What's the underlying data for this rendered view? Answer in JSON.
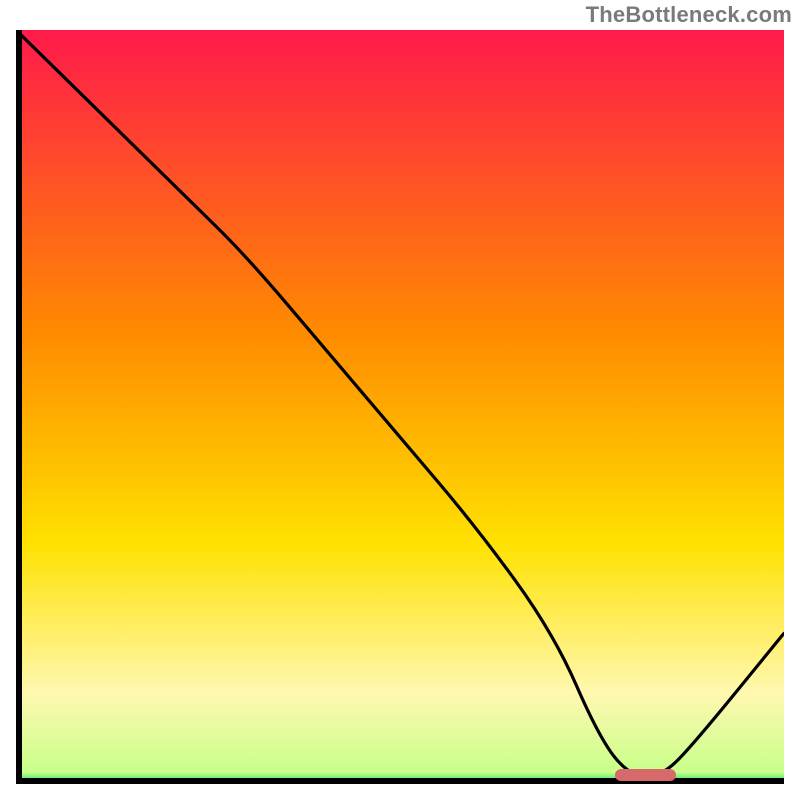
{
  "watermark": "TheBottleneck.com",
  "colors": {
    "gradient_top": "#ff1a4b",
    "gradient_mid1": "#ff8a00",
    "gradient_mid2": "#ffe100",
    "gradient_mid3": "#fff8b0",
    "gradient_bottom": "#00e05a",
    "axis": "#000000",
    "curve": "#000000",
    "marker": "#d66a6a"
  },
  "chart_data": {
    "type": "line",
    "title": "",
    "xlabel": "",
    "ylabel": "",
    "xlim": [
      0,
      100
    ],
    "ylim": [
      0,
      100
    ],
    "x": [
      0,
      22,
      30,
      40,
      50,
      60,
      70,
      76,
      80,
      84,
      88,
      100
    ],
    "y": [
      100,
      78,
      70,
      58,
      46,
      34,
      20,
      6,
      1,
      1,
      5,
      20
    ],
    "marker": {
      "x_start": 78,
      "x_end": 86,
      "y": 1.2
    },
    "gradient_stops": [
      {
        "offset": 0.0,
        "color": "#ff1a4b"
      },
      {
        "offset": 0.4,
        "color": "#ff8a00"
      },
      {
        "offset": 0.68,
        "color": "#ffe100"
      },
      {
        "offset": 0.88,
        "color": "#fff8b0"
      },
      {
        "offset": 0.985,
        "color": "#c8ff8a"
      },
      {
        "offset": 1.0,
        "color": "#00e05a"
      }
    ]
  }
}
